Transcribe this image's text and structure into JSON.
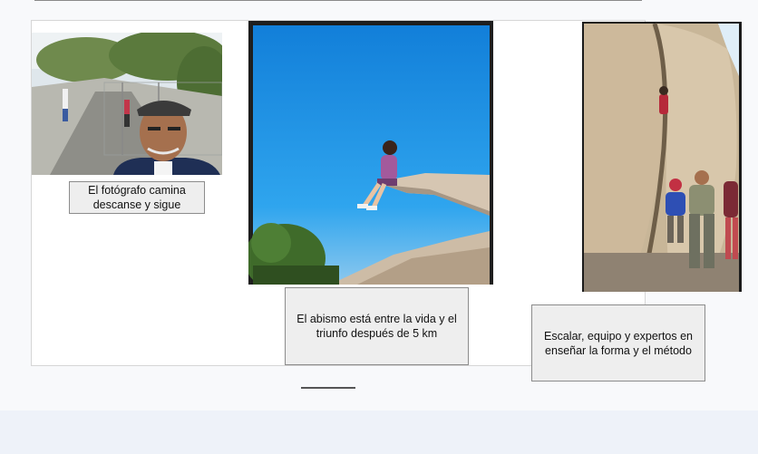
{
  "photos": {
    "photographer": {
      "caption": [
        "El fotógrafo camina",
        "descanse y sigue"
      ]
    },
    "cliff": {
      "caption": [
        "El abismo está entre la vida y el",
        "triunfo después de 5 km"
      ]
    },
    "climbers": {
      "caption": [
        "Escalar, equipo y expertos en",
        "enseñar la forma y el método"
      ]
    }
  },
  "colors": {
    "sky": "#1a8fe3",
    "rock": "#c9b79c",
    "caption_bg": "#eeeeee",
    "page_bg": "#eef2f9"
  }
}
